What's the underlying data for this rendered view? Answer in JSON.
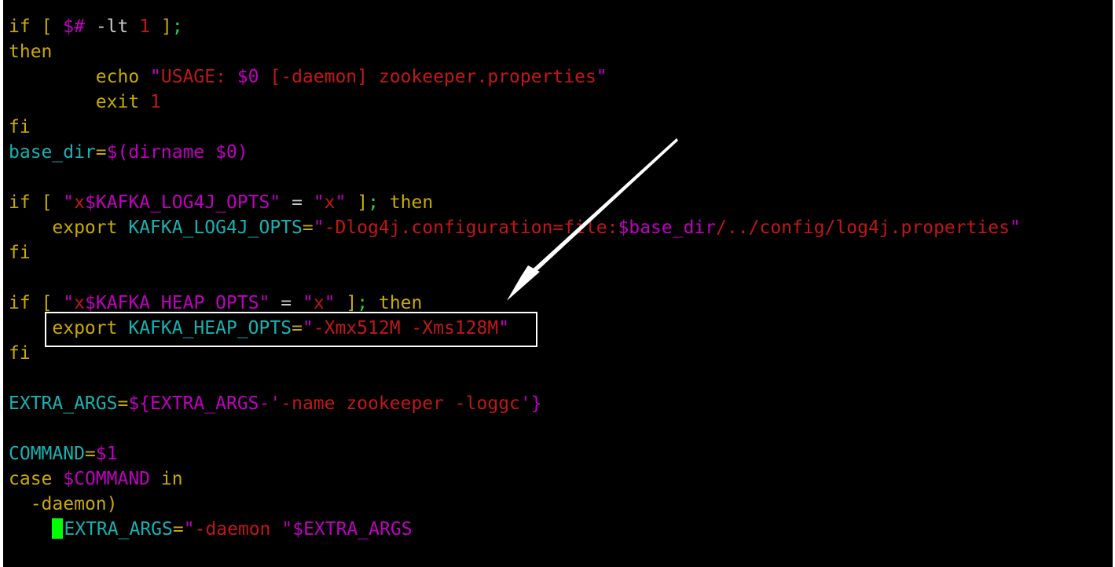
{
  "colors": {
    "background": "#000000",
    "keyword": "#c8aa00",
    "cyan": "#18b2b2",
    "magenta": "#c000c0",
    "red": "#c01818",
    "green": "#30d030",
    "plain": "#c8c8c8",
    "cursor": "#00ff00"
  },
  "lines": [
    [
      {
        "t": "if",
        "c": "keyword"
      },
      {
        "t": " ",
        "c": "plain"
      },
      {
        "t": "[",
        "c": "keyword"
      },
      {
        "t": " ",
        "c": "plain"
      },
      {
        "t": "$#",
        "c": "magenta"
      },
      {
        "t": " -lt ",
        "c": "plain"
      },
      {
        "t": "1",
        "c": "red"
      },
      {
        "t": " ",
        "c": "plain"
      },
      {
        "t": "]",
        "c": "keyword"
      },
      {
        "t": ";",
        "c": "green"
      }
    ],
    [
      {
        "t": "then",
        "c": "keyword"
      }
    ],
    [
      {
        "t": "        ",
        "c": "plain"
      },
      {
        "t": "echo",
        "c": "keyword"
      },
      {
        "t": " ",
        "c": "plain"
      },
      {
        "t": "\"",
        "c": "magenta"
      },
      {
        "t": "USAGE: ",
        "c": "red"
      },
      {
        "t": "$0",
        "c": "magenta"
      },
      {
        "t": " [-daemon] zookeeper.properties",
        "c": "red"
      },
      {
        "t": "\"",
        "c": "magenta"
      }
    ],
    [
      {
        "t": "        ",
        "c": "plain"
      },
      {
        "t": "exit",
        "c": "keyword"
      },
      {
        "t": " ",
        "c": "plain"
      },
      {
        "t": "1",
        "c": "red"
      }
    ],
    [
      {
        "t": "fi",
        "c": "keyword"
      }
    ],
    [
      {
        "t": "base_dir",
        "c": "cyan"
      },
      {
        "t": "=",
        "c": "keyword"
      },
      {
        "t": "$(",
        "c": "magenta"
      },
      {
        "t": "dirname ",
        "c": "magenta"
      },
      {
        "t": "$0",
        "c": "magenta"
      },
      {
        "t": ")",
        "c": "magenta"
      }
    ],
    [
      {
        "t": "",
        "c": "plain"
      }
    ],
    [
      {
        "t": "if",
        "c": "keyword"
      },
      {
        "t": " ",
        "c": "plain"
      },
      {
        "t": "[",
        "c": "keyword"
      },
      {
        "t": " ",
        "c": "plain"
      },
      {
        "t": "\"",
        "c": "magenta"
      },
      {
        "t": "x",
        "c": "red"
      },
      {
        "t": "$KAFKA_LOG4J_OPTS",
        "c": "magenta"
      },
      {
        "t": "\"",
        "c": "magenta"
      },
      {
        "t": " = ",
        "c": "plain"
      },
      {
        "t": "\"",
        "c": "magenta"
      },
      {
        "t": "x",
        "c": "red"
      },
      {
        "t": "\"",
        "c": "magenta"
      },
      {
        "t": " ",
        "c": "plain"
      },
      {
        "t": "]",
        "c": "keyword"
      },
      {
        "t": ";",
        "c": "green"
      },
      {
        "t": " ",
        "c": "plain"
      },
      {
        "t": "then",
        "c": "keyword"
      }
    ],
    [
      {
        "t": "    ",
        "c": "plain"
      },
      {
        "t": "export",
        "c": "keyword"
      },
      {
        "t": " ",
        "c": "plain"
      },
      {
        "t": "KAFKA_LOG4J_OPTS",
        "c": "cyan"
      },
      {
        "t": "=",
        "c": "keyword"
      },
      {
        "t": "\"",
        "c": "magenta"
      },
      {
        "t": "-Dlog4j.configuration=file:",
        "c": "red"
      },
      {
        "t": "$base_dir",
        "c": "magenta"
      },
      {
        "t": "/../config/log4j.properties",
        "c": "red"
      },
      {
        "t": "\"",
        "c": "magenta"
      }
    ],
    [
      {
        "t": "fi",
        "c": "keyword"
      }
    ],
    [
      {
        "t": "",
        "c": "plain"
      }
    ],
    [
      {
        "t": "if",
        "c": "keyword"
      },
      {
        "t": " ",
        "c": "plain"
      },
      {
        "t": "[",
        "c": "keyword"
      },
      {
        "t": " ",
        "c": "plain"
      },
      {
        "t": "\"",
        "c": "magenta"
      },
      {
        "t": "x",
        "c": "red"
      },
      {
        "t": "$KAFKA_HEAP_OPTS",
        "c": "magenta"
      },
      {
        "t": "\"",
        "c": "magenta"
      },
      {
        "t": " = ",
        "c": "plain"
      },
      {
        "t": "\"",
        "c": "magenta"
      },
      {
        "t": "x",
        "c": "red"
      },
      {
        "t": "\"",
        "c": "magenta"
      },
      {
        "t": " ",
        "c": "plain"
      },
      {
        "t": "]",
        "c": "keyword"
      },
      {
        "t": ";",
        "c": "green"
      },
      {
        "t": " ",
        "c": "plain"
      },
      {
        "t": "then",
        "c": "keyword"
      }
    ],
    [
      {
        "t": "    ",
        "c": "plain"
      },
      {
        "t": "export",
        "c": "keyword"
      },
      {
        "t": " ",
        "c": "plain"
      },
      {
        "t": "KAFKA_HEAP_OPTS",
        "c": "cyan"
      },
      {
        "t": "=",
        "c": "keyword"
      },
      {
        "t": "\"",
        "c": "magenta"
      },
      {
        "t": "-Xmx512M -Xms128M",
        "c": "red"
      },
      {
        "t": "\"",
        "c": "magenta"
      }
    ],
    [
      {
        "t": "fi",
        "c": "keyword"
      }
    ],
    [
      {
        "t": "",
        "c": "plain"
      }
    ],
    [
      {
        "t": "EXTRA_ARGS",
        "c": "cyan"
      },
      {
        "t": "=",
        "c": "keyword"
      },
      {
        "t": "${",
        "c": "magenta"
      },
      {
        "t": "EXTRA_ARGS",
        "c": "magenta"
      },
      {
        "t": "-",
        "c": "magenta"
      },
      {
        "t": "'",
        "c": "magenta"
      },
      {
        "t": "-name zookeeper -loggc",
        "c": "red"
      },
      {
        "t": "'",
        "c": "magenta"
      },
      {
        "t": "}",
        "c": "magenta"
      }
    ],
    [
      {
        "t": "",
        "c": "plain"
      }
    ],
    [
      {
        "t": "COMMAND",
        "c": "cyan"
      },
      {
        "t": "=",
        "c": "keyword"
      },
      {
        "t": "$1",
        "c": "magenta"
      }
    ],
    [
      {
        "t": "case",
        "c": "keyword"
      },
      {
        "t": " ",
        "c": "plain"
      },
      {
        "t": "$COMMAND",
        "c": "magenta"
      },
      {
        "t": " ",
        "c": "plain"
      },
      {
        "t": "in",
        "c": "keyword"
      }
    ],
    [
      {
        "t": "  ",
        "c": "plain"
      },
      {
        "t": "-daemon",
        "c": "keyword"
      },
      {
        "t": ")",
        "c": "keyword"
      }
    ],
    [
      {
        "t": "    ",
        "c": "plain"
      },
      {
        "t": "CURSOR",
        "c": "cursor"
      },
      {
        "t": "EXTRA_ARGS",
        "c": "cyan"
      },
      {
        "t": "=",
        "c": "keyword"
      },
      {
        "t": "\"",
        "c": "magenta"
      },
      {
        "t": "-daemon ",
        "c": "red"
      },
      {
        "t": "\"",
        "c": "magenta"
      },
      {
        "t": "$EXTRA_ARGS",
        "c": "magenta"
      }
    ]
  ]
}
